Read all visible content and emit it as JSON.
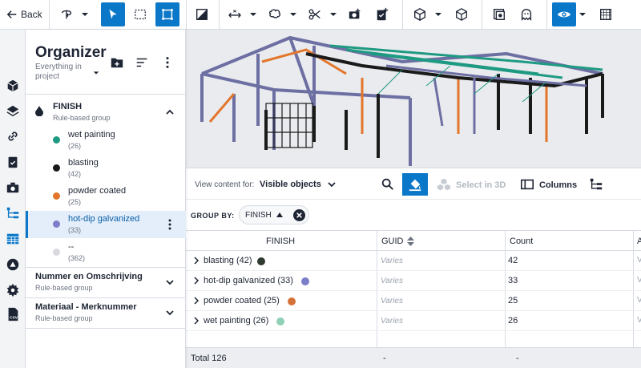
{
  "toolbar": {
    "back_label": "Back",
    "buttons": [
      "rotate-icon",
      "select-pointer-icon",
      "rectangle-select-icon",
      "fit-frame-icon",
      "slope-icon",
      "measure-axis-icon",
      "cloud-markup-icon",
      "scissors-icon",
      "camera-add-icon",
      "clipboard-add-icon",
      "cube-solid-icon",
      "cube-outline-icon",
      "layers-icon",
      "ghost-icon",
      "eye-icon",
      "grid-icon"
    ],
    "active": [
      "select-pointer-icon",
      "fit-frame-icon",
      "eye-icon"
    ],
    "accent": "#0a77c8"
  },
  "organizer": {
    "title": "Organizer",
    "scope": "Everything in project",
    "groups": [
      {
        "name": "FINISH",
        "type": "Rule-based group",
        "expanded": true,
        "items": [
          {
            "label": "wet painting",
            "count": "(26)",
            "color": "#1f9a82"
          },
          {
            "label": "blasting",
            "count": "(42)",
            "color": "#1a1a1a"
          },
          {
            "label": "powder coated",
            "count": "(25)",
            "color": "#e3762b"
          },
          {
            "label": "hot-dip galvanized",
            "count": "(33)",
            "color": "#7b7ec9",
            "selected": true
          },
          {
            "label": "--",
            "count": "(362)",
            "color": "#d8dadf"
          }
        ]
      },
      {
        "name": "Nummer en Omschrijving",
        "type": "Rule-based group",
        "expanded": false
      },
      {
        "name": "Materiaal - Merknummer",
        "type": "Rule-based group",
        "expanded": false
      }
    ]
  },
  "content_controls": {
    "view_for_label": "View content for:",
    "view_for_value": "Visible objects",
    "select_3d_label": "Select in 3D",
    "columns_label": "Columns"
  },
  "group_by": {
    "label": "GROUP BY:",
    "chip": "FINISH"
  },
  "table": {
    "columns": [
      "FINISH",
      "GUID",
      "Count",
      "A"
    ],
    "rows": [
      {
        "name": "blasting (42)",
        "dot": "#2e3a2f",
        "guid": "Varies",
        "count": "42",
        "last": "Va"
      },
      {
        "name": "hot-dip galvanized (33)",
        "dot": "#7b7ec9",
        "guid": "Varies",
        "count": "33",
        "last": "Va"
      },
      {
        "name": "powder coated (25)",
        "dot": "#d4723a",
        "guid": "Varies",
        "count": "25",
        "last": "Va"
      },
      {
        "name": "wet painting (26)",
        "dot": "#8fd0b6",
        "guid": "Varies",
        "count": "26",
        "last": "Va"
      }
    ],
    "total_label": "Total 126",
    "total_guid": "-",
    "total_count": "-"
  }
}
